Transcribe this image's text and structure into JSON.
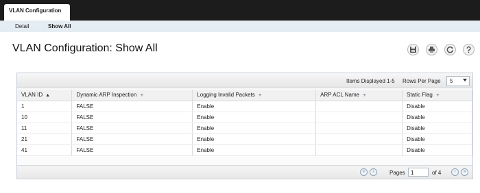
{
  "main_tab": {
    "label": "VLAN Configuration"
  },
  "subtabs": [
    {
      "label": "Detail"
    },
    {
      "label": "Show All"
    }
  ],
  "page_title": "VLAN Configuration: Show All",
  "toolbar_icons": [
    "save-icon",
    "print-icon",
    "refresh-icon",
    "help-icon"
  ],
  "table_toolbar": {
    "items_displayed": "Items Displayed 1-5",
    "rows_per_page_label": "Rows Per Page",
    "rows_per_page_value": "5"
  },
  "columns": [
    "VLAN ID",
    "Dynamic ARP Inspection",
    "Logging Invalid Packets",
    "ARP ACL Name",
    "Static Flag"
  ],
  "rows": [
    [
      "1",
      "FALSE",
      "Enable",
      "",
      "Disable"
    ],
    [
      "10",
      "FALSE",
      "Enable",
      "",
      "Disable"
    ],
    [
      "11",
      "FALSE",
      "Enable",
      "",
      "Disable"
    ],
    [
      "21",
      "FALSE",
      "Enable",
      "",
      "Disable"
    ],
    [
      "41",
      "FALSE",
      "Enable",
      "",
      "Disable"
    ]
  ],
  "pager": {
    "pages_label": "Pages",
    "current_page": "1",
    "of_label": "of 4"
  }
}
